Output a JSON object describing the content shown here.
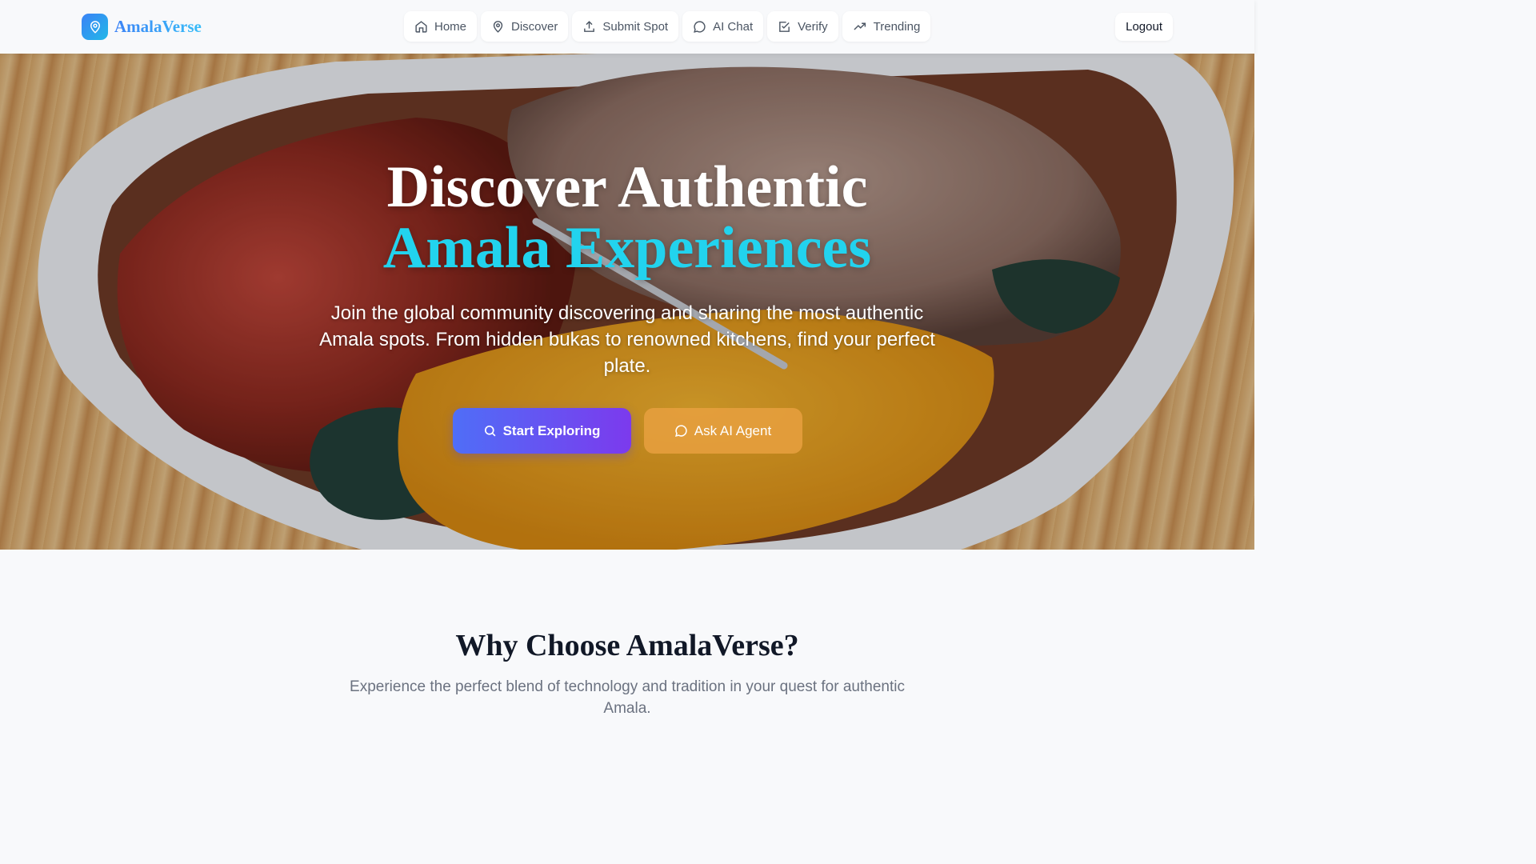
{
  "brand": {
    "name": "AmalaVerse",
    "logo_icon": "map-pin-icon",
    "colors": [
      "#3b82f6",
      "#38bdf8"
    ]
  },
  "nav": {
    "items": [
      {
        "label": "Home",
        "icon": "home-icon"
      },
      {
        "label": "Discover",
        "icon": "map-pin-icon"
      },
      {
        "label": "Submit Spot",
        "icon": "upload-icon"
      },
      {
        "label": "AI Chat",
        "icon": "chat-bubble-icon"
      },
      {
        "label": "Verify",
        "icon": "check-square-icon"
      },
      {
        "label": "Trending",
        "icon": "trending-up-icon"
      }
    ],
    "logout_label": "Logout"
  },
  "hero": {
    "title_line1": "Discover Authentic",
    "title_line2": "Amala Experiences",
    "subtitle": "Join the global community discovering and sharing the most authentic Amala spots. From hidden bukas to renowned kitchens, find your perfect plate.",
    "primary_cta": "Start Exploring",
    "secondary_cta": "Ask AI Agent",
    "accent_color": "#22d3ee"
  },
  "why": {
    "title": "Why Choose AmalaVerse?",
    "subtitle": "Experience the perfect blend of technology and tradition in your quest for authentic Amala."
  }
}
